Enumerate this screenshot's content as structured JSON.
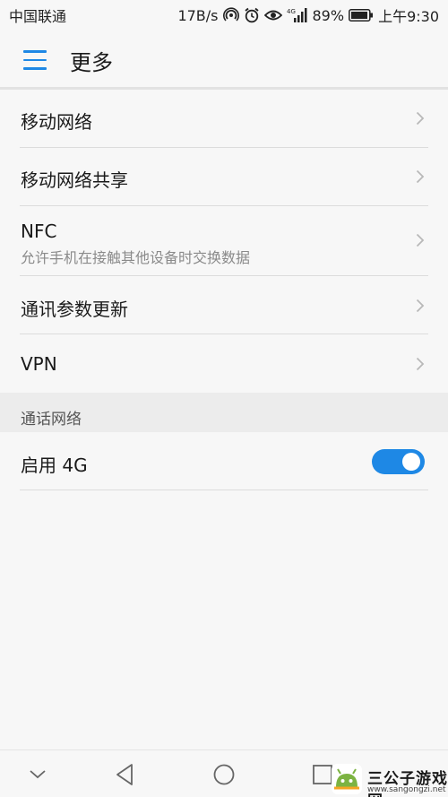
{
  "status_bar": {
    "carrier": "中国联通",
    "speed": "17B/s",
    "network": "4G",
    "battery": "89%",
    "time": "上午9:30"
  },
  "header": {
    "title": "更多"
  },
  "list": {
    "items": [
      {
        "label": "移动网络"
      },
      {
        "label": "移动网络共享"
      },
      {
        "label": "NFC",
        "subtitle": "允许手机在接触其他设备时交换数据"
      },
      {
        "label": "通讯参数更新"
      },
      {
        "label": "VPN"
      }
    ]
  },
  "section": {
    "title": "通话网络",
    "items": [
      {
        "label": "启用 4G",
        "enabled": true
      }
    ]
  },
  "colors": {
    "accent": "#1e88e5"
  },
  "watermark": {
    "title": "三公子游戏网",
    "url": "www.sangongzi.net"
  }
}
